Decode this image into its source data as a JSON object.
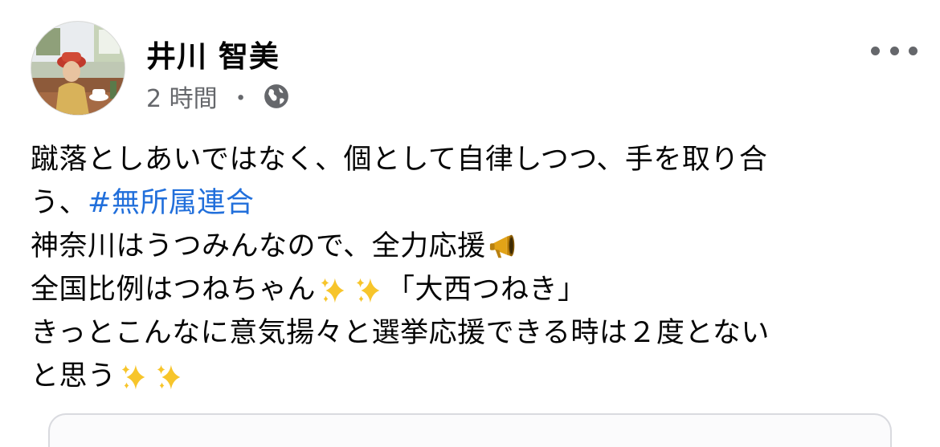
{
  "post": {
    "author_name": "井川 智美",
    "timestamp": "2 時間",
    "separator": "・",
    "privacy_icon": "globe-icon",
    "more_icon": "more-horizontal-icon",
    "avatar_icon": "profile-photo",
    "text_lines": {
      "l1": "蹴落としあいではなく、個として自律しつつ、手を取り合",
      "l2_pre": "う、",
      "hashtag": "#無所属連合",
      "l3": "神奈川はうつみんなので、全力応援",
      "l4_pre": "全国比例はつねちゃん",
      "l4_post": "「大西つねき」",
      "l5": "きっとこんなに意気揚々と選挙応援できる時は２度とない",
      "l6": "と思う"
    },
    "emoji": {
      "megaphone": "megaphone-emoji",
      "sparkles": "sparkles-emoji"
    },
    "colors": {
      "hashtag": "#216fdb",
      "meta_text": "#65676b",
      "text": "#050505"
    }
  }
}
